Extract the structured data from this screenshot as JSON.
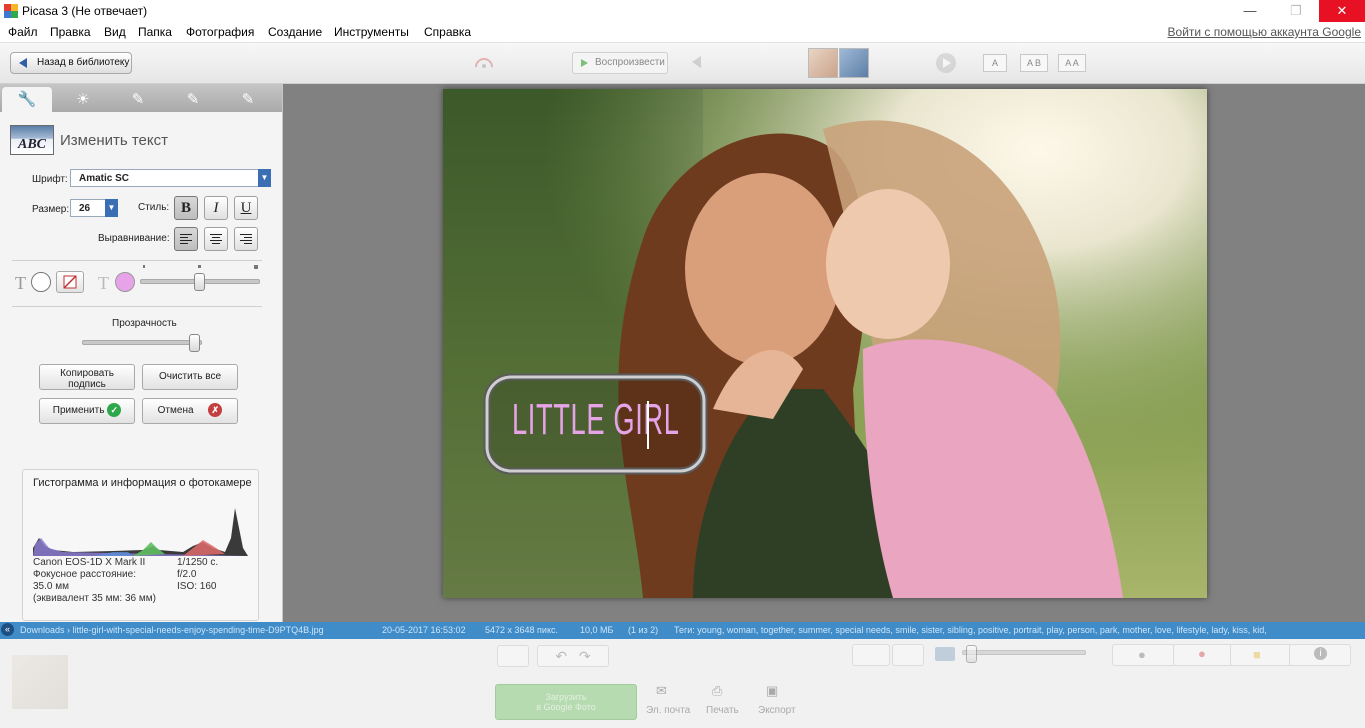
{
  "window": {
    "title": "Picasa 3 (Не отвечает)",
    "controls": {
      "minimize": "—",
      "maximize": "❐",
      "close": "✕"
    }
  },
  "menubar": {
    "items": [
      "Файл",
      "Правка",
      "Вид",
      "Папка",
      "Фотография",
      "Создание",
      "Инструменты",
      "Справка"
    ],
    "signin": "Войти с помощью аккаунта Google"
  },
  "toolbar": {
    "back_label": "Назад в библиотеку",
    "play_label": "Воспроизвести",
    "caption_buttons": [
      "A",
      "A B",
      "A A"
    ]
  },
  "tabs": [
    "basic-fixes",
    "tuning",
    "effects-1",
    "effects-2",
    "effects-3"
  ],
  "text_panel": {
    "title": "Изменить текст",
    "thumb_label": "ABC",
    "font_label": "Шрифт:",
    "font_value": "Amatic SC",
    "size_label": "Размер:",
    "size_value": "26",
    "style_label": "Стиль:",
    "style_buttons": {
      "bold": "B",
      "italic": "I",
      "underline": "U"
    },
    "align_label": "Выравнивание:",
    "text_color": "#ffffff",
    "outline_color": "none",
    "outline_fill_color": "#e7a3e8",
    "transparency_label": "Прозрачность",
    "copy_label_line1": "Копировать",
    "copy_label_line2": "подпись",
    "clear_label": "Очистить все",
    "apply_label": "Применить",
    "cancel_label": "Отмена"
  },
  "histogram": {
    "title": "Гистограмма и информация о фотокамере",
    "camera": "Canon EOS-1D X Mark II",
    "focal_label": "Фокусное расстояние:",
    "focal_value": "35.0 мм",
    "equiv": "(эквивалент 35 мм: 36 мм)",
    "shutter": "1/1250 с.",
    "aperture": "f/2.0",
    "iso": "ISO: 160"
  },
  "photo": {
    "overlay_text": "LITTLE GIRL"
  },
  "statusbar": {
    "path": "Downloads › little-girl-with-special-needs-enjoy-spending-time-D9PTQ4B.jpg",
    "date": "20-05-2017 16:53:02",
    "dimensions": "5472 x 3648 пикс.",
    "size": "10,0 МБ",
    "position": "(1 из 2)",
    "tags": "Теги: young, woman, together, summer, special needs, smile, sister, sibling, positive, portrait, play, person, park, mother, love, lifestyle, lady, kiss, kid,"
  },
  "bottom": {
    "email_label": "Эл. почта",
    "print_label": "Печать",
    "export_label": "Экспорт",
    "upload_line1": "Загрузить",
    "upload_line2": "в Google Фото"
  }
}
